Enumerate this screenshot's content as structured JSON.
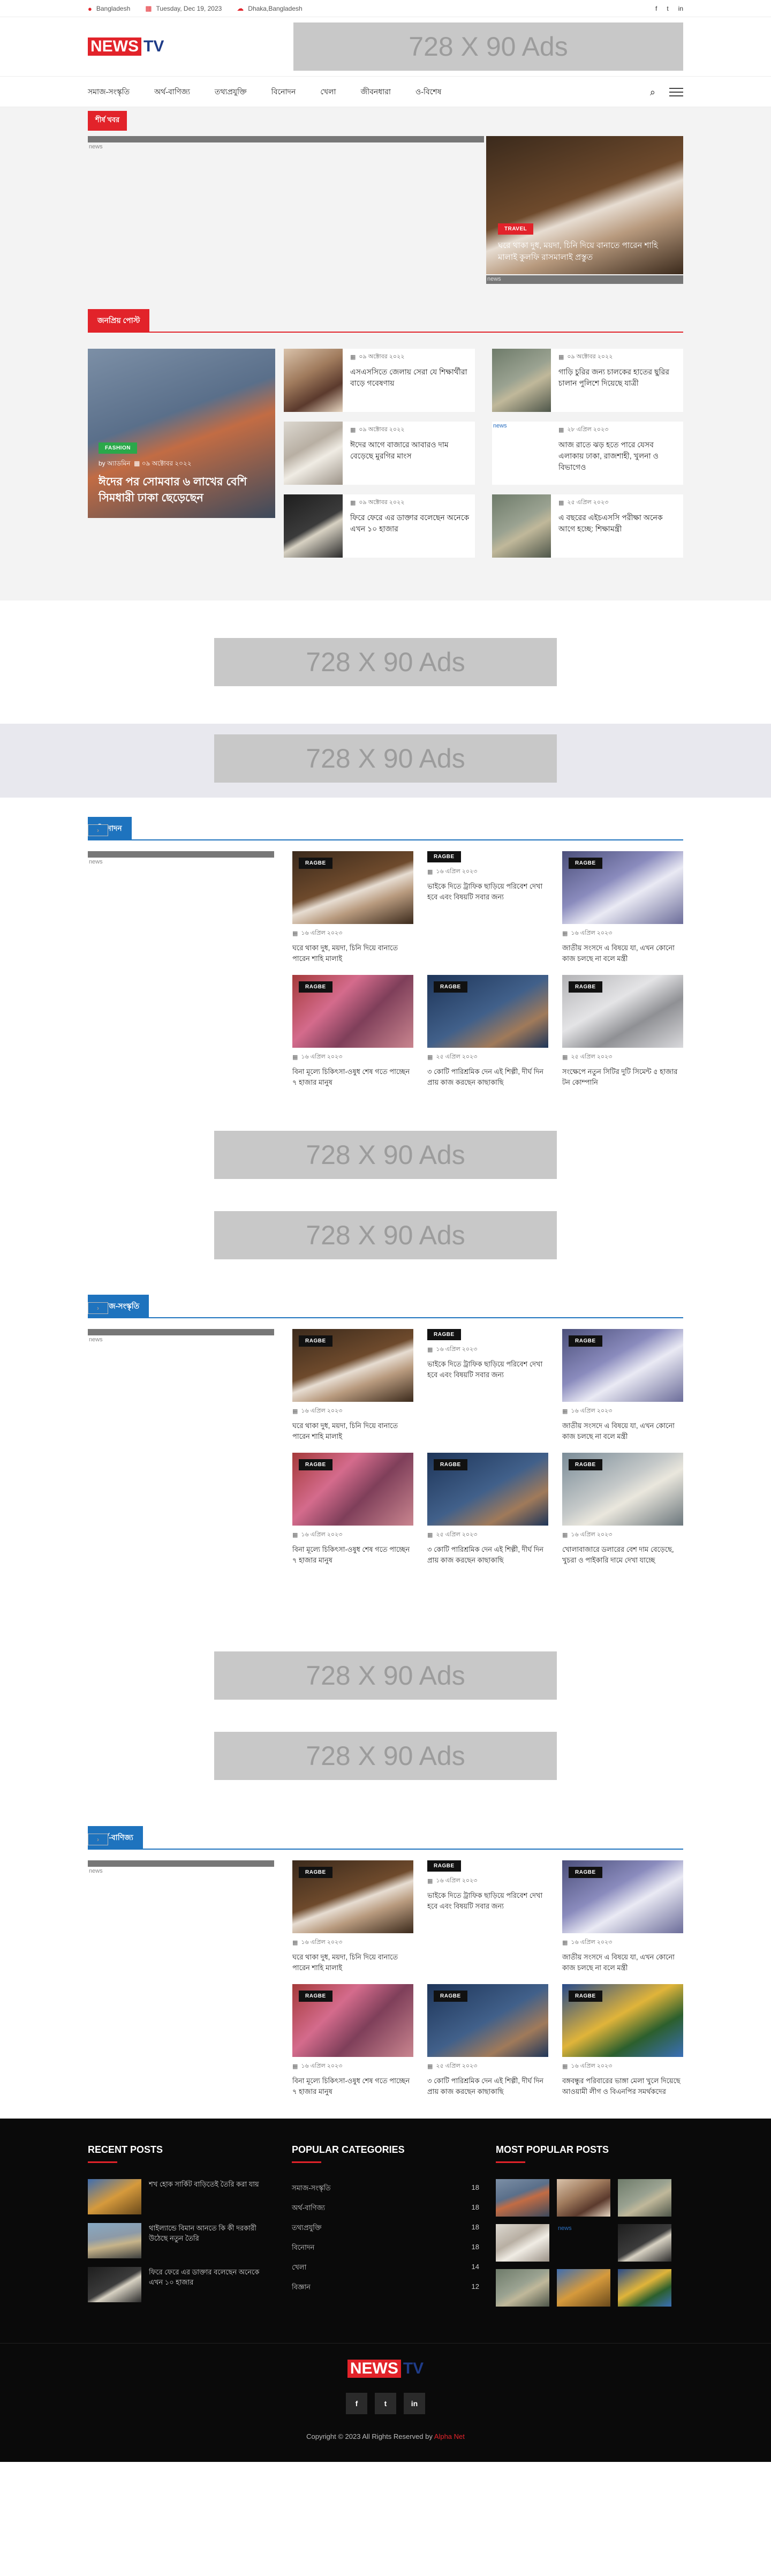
{
  "topbar": {
    "location": "Bangladesh",
    "date": "Tuesday, Dec 19, 2023",
    "weather": "Dhaka,Bangladesh"
  },
  "logo": {
    "news": "NEWS",
    "tv": "TV"
  },
  "ads": {
    "label": "728 X 90 Ads"
  },
  "nav": {
    "items": [
      "সমাজ-সংস্কৃতি",
      "অর্থ-বাণিজ্য",
      "তথ্যপ্রযুক্তি",
      "বিনোদন",
      "খেলা",
      "জীবনধারা",
      "ও-বিশেষ"
    ]
  },
  "lead": {
    "heading": "শীর্ষ খবর",
    "broken_left": "news",
    "card": {
      "tag": "TRAVEL",
      "title": "ঘরে থাকা দুধ, ময়দা, চিনি দিয়ে বানাতে পারেন শাহি মালাই কুলফি রাসমালাই প্রস্তুত"
    },
    "broken_right": "news"
  },
  "popular": {
    "heading": "জনপ্রিয় পোস্ট",
    "big": {
      "tag": "FASHION",
      "author": "অ্যাডমিন",
      "date": "০৯ অক্টোবর ২০২২",
      "title": "ঈদের পর সোমবার ৬ লাখের বেশি সিমধারী ঢাকা ছেড়েছেন"
    },
    "items": [
      {
        "date": "০৯ অক্টোবর ২০২২",
        "title": "এসএসসিতে জেলায় সেরা যে শিক্ষার্থীরা বাড়ে গবেষণায়"
      },
      {
        "date": "০৯ অক্টোবর ২০২২",
        "title": "গাড়ি চুরির জন্য চালকের হাতের ছুরির চালান পুলিশে দিয়েছে যাত্রী"
      },
      {
        "date": "০৯ অক্টোবর ২০২২",
        "title": "ঈদের আগে বাজারে আবারও দাম বেড়েছে মুরগির মাংস"
      },
      {
        "date": "২৮ এপ্রিল ২০২৩",
        "title": "আজ রাতে ঝড় হতে পারে যেসব এলাকায় ঢাকা, রাজশাহী, খুলনা ও বিভাগেও"
      },
      {
        "date": "০৯ অক্টোবর ২০২২",
        "title": "ফিরে ফেরে এর ডাক্তার বলেছেন অনেকে এখন ১০ হাজার"
      },
      {
        "date": "২৫ এপ্রিল ২০২৩",
        "title": "এ বছরের এইচএসসি পরীক্ষা অনেক আগে হচ্ছে: শিক্ষামন্ত্রী"
      }
    ]
  },
  "sections": [
    {
      "heading": "বিনোদন",
      "cards": [
        {
          "tag": "RAGBE",
          "date": "১৬ এপ্রিল ২০২৩",
          "title": "ঘরে থাকা দুধ, ময়দা, চিনি দিয়ে বানাতে পারেন শাহি মালাই"
        },
        {
          "tag": "RAGBE",
          "date": "১৬ এপ্রিল ২০২৩",
          "title": "ভাইকে দিতে ট্রাফিক ছাড়িয়ে পরিবেশ দেখা হবে এবং বিষয়টি সবার জন্য"
        },
        {
          "tag": "RAGBE",
          "date": "১৬ এপ্রিল ২০২৩",
          "title": "জাতীয় সংসদে এ বিষয়ে যা, এখন কোনো কাজ চলছে না বলে মন্ত্রী"
        },
        {
          "tag": "RAGBE",
          "date": "১৬ এপ্রিল ২০২৩",
          "title": "বিনা মূল্যে চিকিৎসা-ওষুধ শেষ গতে পাচ্ছেন ৭ হাজার মানুষ"
        },
        {
          "tag": "RAGBE",
          "date": "২৫ এপ্রিল ২০২৩",
          "title": "৩ কোটি পারিশ্রমিক দেন এই শিল্পী, দীর্ঘ দিন প্রায় কাজ করছেন কাছাকাছি"
        },
        {
          "tag": "RAGBE",
          "date": "২৫ এপ্রিল ২০২৩",
          "title": "সংক্ষেপে নতুন সিটির দুটি সিমেন্ট ৫ হাজার টন কোম্পানি"
        }
      ]
    },
    {
      "heading": "সমাজ-সংস্কৃতি",
      "cards": [
        {
          "tag": "RAGBE",
          "date": "১৬ এপ্রিল ২০২৩",
          "title": "ঘরে থাকা দুধ, ময়দা, চিনি দিয়ে বানাতে পারেন শাহি মালাই"
        },
        {
          "tag": "RAGBE",
          "date": "১৬ এপ্রিল ২০২৩",
          "title": "ভাইকে দিতে ট্রাফিক ছাড়িয়ে পরিবেশ দেখা হবে এবং বিষয়টি সবার জন্য"
        },
        {
          "tag": "RAGBE",
          "date": "১৬ এপ্রিল ২০২৩",
          "title": "জাতীয় সংসদে এ বিষয়ে যা, এখন কোনো কাজ চলছে না বলে মন্ত্রী"
        },
        {
          "tag": "RAGBE",
          "date": "১৬ এপ্রিল ২০২৩",
          "title": "বিনা মূল্যে চিকিৎসা-ওষুধ শেষ গতে পাচ্ছেন ৭ হাজার মানুষ"
        },
        {
          "tag": "RAGBE",
          "date": "২৫ এপ্রিল ২০২৩",
          "title": "৩ কোটি পারিশ্রমিক দেন এই শিল্পী, দীর্ঘ দিন প্রায় কাজ করছেন কাছাকাছি"
        },
        {
          "tag": "RAGBE",
          "date": "১৬ এপ্রিল ২০২৩",
          "title": "খোলাবাজারে ডলারের বেশ দাম বেড়েছে, খুচরা ও পাইকারি দামে দেখা যাচ্ছে"
        }
      ]
    },
    {
      "heading": "অর্থ-বাণিজ্য",
      "cards": [
        {
          "tag": "RAGBE",
          "date": "১৬ এপ্রিল ২০২৩",
          "title": "ঘরে থাকা দুধ, ময়দা, চিনি দিয়ে বানাতে পারেন শাহি মালাই"
        },
        {
          "tag": "RAGBE",
          "date": "১৬ এপ্রিল ২০২৩",
          "title": "ভাইকে দিতে ট্রাফিক ছাড়িয়ে পরিবেশ দেখা হবে এবং বিষয়টি সবার জন্য"
        },
        {
          "tag": "RAGBE",
          "date": "১৬ এপ্রিল ২০২৩",
          "title": "জাতীয় সংসদে এ বিষয়ে যা, এখন কোনো কাজ চলছে না বলে মন্ত্রী"
        },
        {
          "tag": "RAGBE",
          "date": "১৬ এপ্রিল ২০২৩",
          "title": "বিনা মূল্যে চিকিৎসা-ওষুধ শেষ গতে পাচ্ছেন ৭ হাজার মানুষ"
        },
        {
          "tag": "RAGBE",
          "date": "২৫ এপ্রিল ২০২৩",
          "title": "৩ কোটি পারিশ্রমিক দেন এই শিল্পী, দীর্ঘ দিন প্রায় কাজ করছেন কাছাকাছি"
        },
        {
          "tag": "RAGBE",
          "date": "১৬ এপ্রিল ২০২৩",
          "title": "বঙ্গবন্ধুর পরিবারের ভাঙ্গা মেলা খুলে দিয়েছে আওয়ামী লীগ ও বিএনপির সমর্থকদের"
        }
      ]
    }
  ],
  "footer": {
    "recent_heading": "RECENT POSTS",
    "recent": [
      "শখ হোক সার্কিট বাড়িতেই তৈরি করা যায়",
      "থাইল্যান্ডে বিমান আনতে কি কী দরকারী উঠেছে নতুন তৈরি",
      "ফিরে ফেরে এর ডাক্তার বলেছেন অনেকে এখন ১০ হাজার"
    ],
    "cat_heading": "POPULAR CATEGORIES",
    "categories": [
      {
        "name": "সমাজ-সংস্কৃতি",
        "count": "18"
      },
      {
        "name": "অর্থ-বাণিজ্য",
        "count": "18"
      },
      {
        "name": "তথ্যপ্রযুক্তি",
        "count": "18"
      },
      {
        "name": "বিনোদন",
        "count": "18"
      },
      {
        "name": "খেলা",
        "count": "14"
      },
      {
        "name": "বিজ্ঞান",
        "count": "12"
      }
    ],
    "popular_heading": "MOST POPULAR POSTS",
    "copyright": "Copyright © 2023 All Rights Reserved by",
    "copyright_brand": "Alpha Net"
  },
  "colors": {
    "accent": "#e2232a",
    "blue": "#1e73be"
  }
}
